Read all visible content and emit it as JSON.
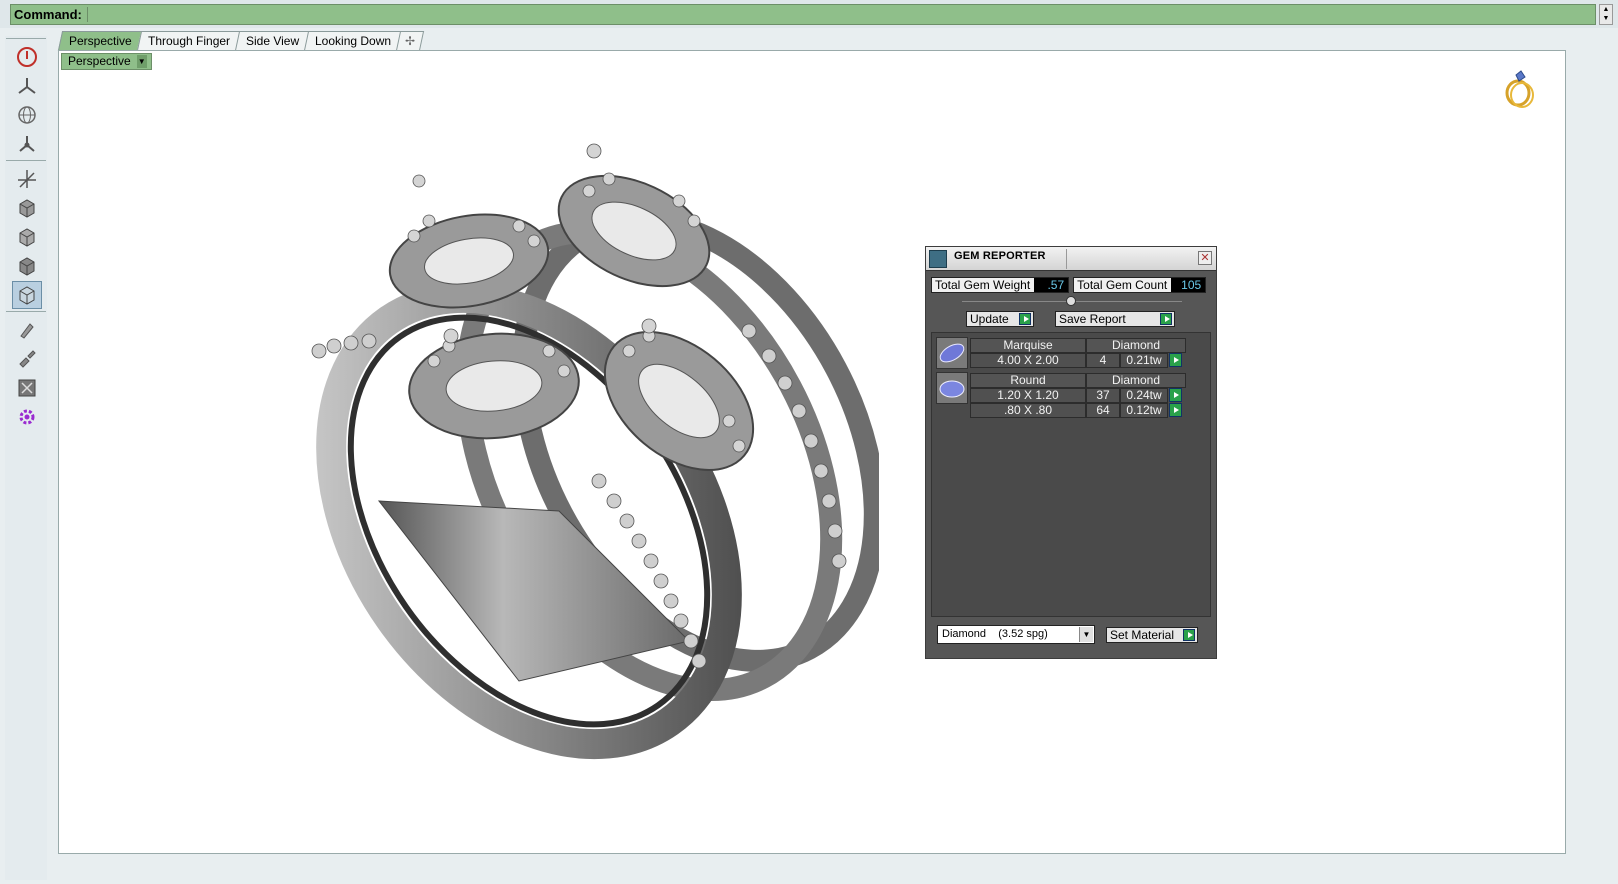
{
  "command_bar": {
    "label": "Command:",
    "value": ""
  },
  "tabs": [
    {
      "label": "Perspective",
      "active": true
    },
    {
      "label": "Through Finger",
      "active": false
    },
    {
      "label": "Side View",
      "active": false
    },
    {
      "label": "Looking Down",
      "active": false
    }
  ],
  "add_tab_icon": "plus-icon",
  "viewport": {
    "view_label": "Perspective"
  },
  "toolbar": {
    "icons": [
      "power-icon",
      "axes-icon",
      "globe-icon",
      "tripod-icon",
      "move-axes-icon",
      "box-front-icon",
      "box-side-icon",
      "box-top-icon",
      "box-perspective-icon",
      "paint-icon",
      "brush-icon",
      "fit-view-icon",
      "gear-icon"
    ]
  },
  "gem_reporter": {
    "title": "GEM REPORTER",
    "total_gem_weight_label": "Total Gem Weight",
    "total_gem_weight": ".57",
    "total_gem_count_label": "Total Gem Count",
    "total_gem_count": "105",
    "update_label": "Update",
    "save_report_label": "Save Report",
    "groups": [
      {
        "shape": "Marquise",
        "material": "Diamond",
        "rows": [
          {
            "size": "4.00 X 2.00",
            "count": "4",
            "weight": "0.21tw"
          }
        ]
      },
      {
        "shape": "Round",
        "material": "Diamond",
        "rows": [
          {
            "size": "1.20 X 1.20",
            "count": "37",
            "weight": "0.24tw"
          },
          {
            "size": ".80 X .80",
            "count": "64",
            "weight": "0.12tw"
          }
        ]
      }
    ],
    "material_select": "Diamond    (3.52 spg)",
    "set_material_label": "Set Material"
  },
  "colors": {
    "accent_green": "#8fbf8a",
    "value_cyan": "#6ac9e9",
    "panel_bg": "#565656"
  }
}
